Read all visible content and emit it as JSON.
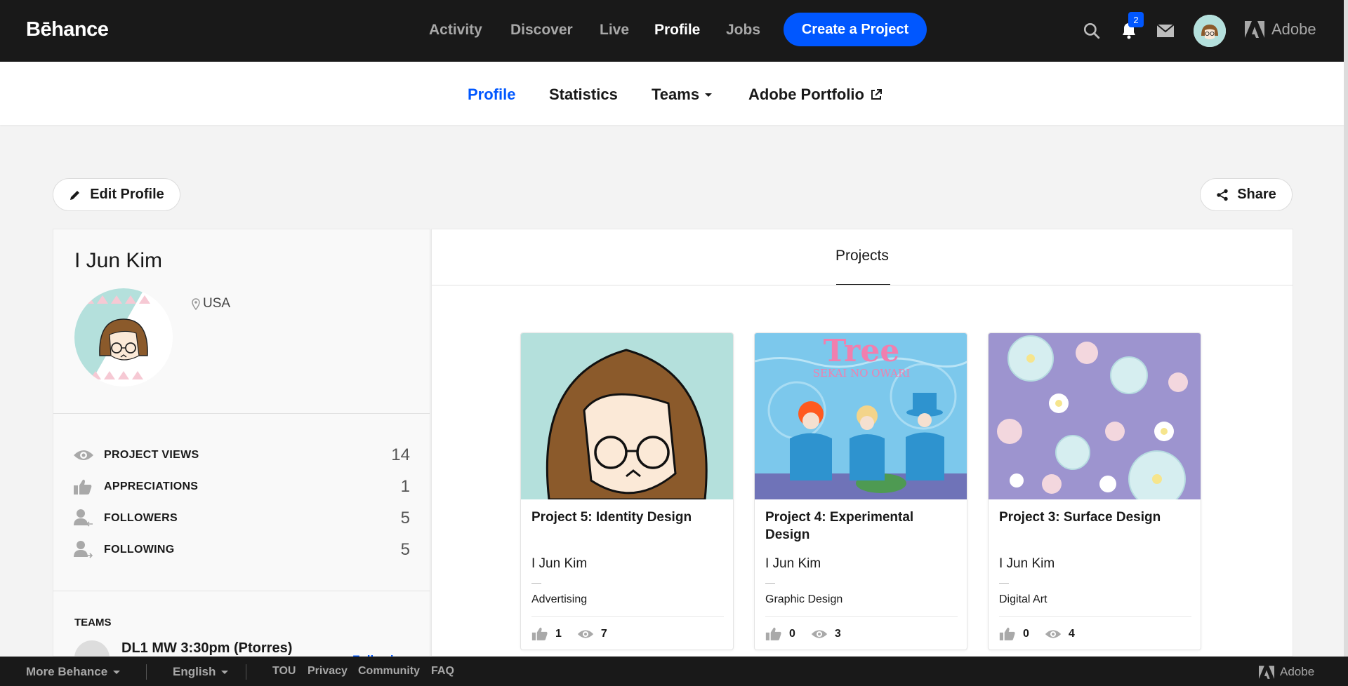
{
  "brand": {
    "logo": "Bēhance",
    "adobe": "Adobe"
  },
  "topnav": {
    "items": [
      "Activity",
      "Discover",
      "Live",
      "Profile",
      "Jobs"
    ],
    "active": "Profile",
    "create_label": "Create a Project",
    "notification_count": "2"
  },
  "subnav": {
    "items": [
      "Profile",
      "Statistics",
      "Teams",
      "Adobe Portfolio"
    ],
    "active": "Profile"
  },
  "actions": {
    "edit_profile": "Edit Profile",
    "share": "Share"
  },
  "profile": {
    "name": "I Jun Kim",
    "location": "USA",
    "stats": [
      {
        "label": "PROJECT VIEWS",
        "value": "14",
        "icon": "eye-icon"
      },
      {
        "label": "APPRECIATIONS",
        "value": "1",
        "icon": "thumbs-up-icon"
      },
      {
        "label": "FOLLOWERS",
        "value": "5",
        "icon": "followers-icon"
      },
      {
        "label": "FOLLOWING",
        "value": "5",
        "icon": "following-icon"
      }
    ],
    "teams_heading": "TEAMS",
    "team": {
      "name": "DL1 MW 3:30pm (Ptorres)",
      "status": "Following"
    }
  },
  "projects": {
    "tab_label": "Projects",
    "cards": [
      {
        "title": "Project 5: Identity Design",
        "owner": "I Jun Kim",
        "category": "Advertising",
        "appreciations": "1",
        "views": "7"
      },
      {
        "title": "Project 4: Experimental Design",
        "owner": "I Jun Kim",
        "category": "Graphic Design",
        "appreciations": "0",
        "views": "3",
        "thumb_title": "Tree",
        "thumb_subtitle": "SEKAI NO OWARI"
      },
      {
        "title": "Project 3: Surface Design",
        "owner": "I Jun Kim",
        "category": "Digital Art",
        "appreciations": "0",
        "views": "4"
      }
    ]
  },
  "footer": {
    "more": "More Behance",
    "language": "English",
    "links": [
      "TOU",
      "Privacy",
      "Community",
      "FAQ"
    ],
    "adobe": "Adobe"
  },
  "colors": {
    "accent": "#0057ff",
    "dark": "#191919"
  }
}
